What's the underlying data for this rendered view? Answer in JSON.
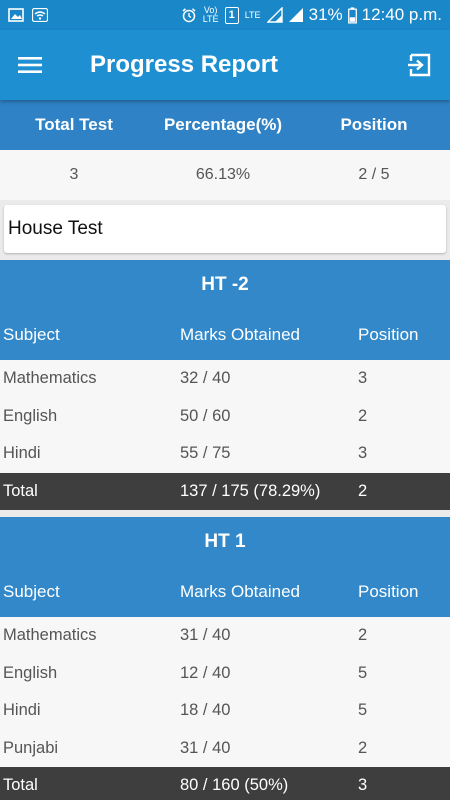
{
  "status_bar": {
    "battery_percent": "31%",
    "time": "12:40 p.m.",
    "volte_label": "Vo) LTE",
    "sim_label": "1",
    "lte_label": "LTE"
  },
  "app_bar": {
    "title": "Progress Report"
  },
  "summary": {
    "headers": [
      "Total Test",
      "Percentage(%)",
      "Position"
    ],
    "values": [
      "3",
      "66.13%",
      "2 / 5"
    ]
  },
  "exam_type_select": {
    "selected": "House Test"
  },
  "exams": [
    {
      "title": "HT -2",
      "headers": [
        "Subject",
        "Marks Obtained",
        "Position"
      ],
      "rows": [
        [
          "Mathematics",
          "32 / 40",
          "3"
        ],
        [
          "English",
          "50 / 60",
          "2"
        ],
        [
          "Hindi",
          "55 / 75",
          "3"
        ]
      ],
      "total": [
        "Total",
        "137 / 175 (78.29%)",
        "2"
      ]
    },
    {
      "title": "HT 1",
      "headers": [
        "Subject",
        "Marks Obtained",
        "Position"
      ],
      "rows": [
        [
          "Mathematics",
          "31 / 40",
          "2"
        ],
        [
          "English",
          "12 / 40",
          "5"
        ],
        [
          "Hindi",
          "18 / 40",
          "5"
        ],
        [
          "Punjabi",
          "31 / 40",
          "2"
        ]
      ],
      "total": [
        "Total",
        "80 / 160 (50%)",
        "3"
      ]
    }
  ],
  "icons": {
    "menu": "hamburger-icon",
    "logout": "logout-icon",
    "gallery": "gallery-icon",
    "wifi": "wifi-icon",
    "alarm": "alarm-icon",
    "signal": "signal-icon",
    "battery": "battery-icon"
  }
}
